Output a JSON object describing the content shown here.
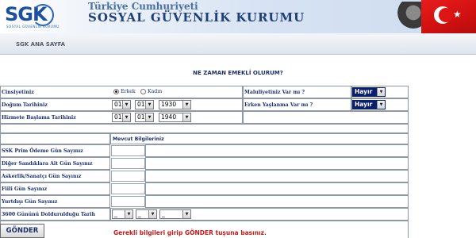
{
  "header": {
    "logo_text": "SGK",
    "logo_subtext": "SOSYAL GÜVENLİK KURUMU",
    "government_title": "Türkiye Cumhuriyeti",
    "institution_title": "SOSYAL GÜVENLİK KURUMU"
  },
  "nav": {
    "home_link": "SGK ANA SAYFA"
  },
  "page": {
    "heading": "NE ZAMAN EMEKLİ OLURUM?"
  },
  "form": {
    "gender": {
      "label": "Cinsiyetiniz",
      "options": [
        "Erkek",
        "Kadın"
      ],
      "selected": "Erkek"
    },
    "disability": {
      "label": "Maluliyetiniz Var mı ?",
      "value": "Hayır"
    },
    "birth_date": {
      "label": "Doğum Tarihiniz",
      "day": "01",
      "month": "01",
      "year": "1930"
    },
    "early_aging": {
      "label": "Erken Yaşlanma Var mı ?",
      "value": "Hayır"
    },
    "service_start": {
      "label": "Hizmete Başlama Tarihiniz",
      "day": "01",
      "month": "01",
      "year": "1940"
    },
    "section_title": "Mevcut  Bilgileriniz",
    "fields": [
      {
        "label": "SSK Prim Ödeme Gün Sayınız",
        "value": ""
      },
      {
        "label": "Diğer Sandıklara Ait Gün Sayınız",
        "value": ""
      },
      {
        "label": "Askerlik/Sanatçı Gün Sayınız",
        "value": ""
      },
      {
        "label": "Fiili Gün Sayınız",
        "value": ""
      },
      {
        "label": "Yurtdışı Gün Sayınız",
        "value": ""
      }
    ],
    "completion_date": {
      "label": "3600 Gününü Doldurulduğu Tarih",
      "day": "_",
      "month": "_",
      "year": "_"
    },
    "submit_label": "GÖNDER",
    "message": "Gerekli bilgileri girip GÖNDER tuşuna basınız."
  }
}
